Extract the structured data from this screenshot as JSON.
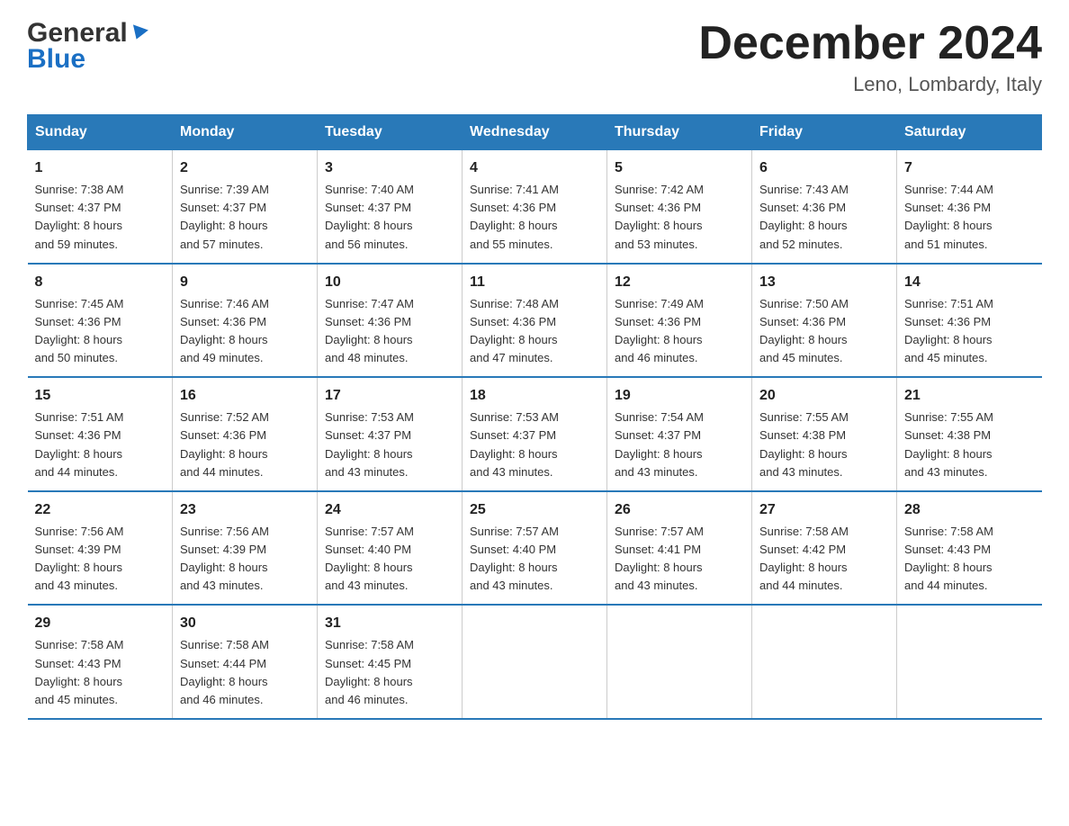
{
  "logo": {
    "general": "General",
    "blue": "Blue"
  },
  "title": {
    "month_year": "December 2024",
    "location": "Leno, Lombardy, Italy"
  },
  "headers": [
    "Sunday",
    "Monday",
    "Tuesday",
    "Wednesday",
    "Thursday",
    "Friday",
    "Saturday"
  ],
  "weeks": [
    [
      {
        "day": "1",
        "sunrise": "Sunrise: 7:38 AM",
        "sunset": "Sunset: 4:37 PM",
        "daylight": "Daylight: 8 hours",
        "daylight2": "and 59 minutes."
      },
      {
        "day": "2",
        "sunrise": "Sunrise: 7:39 AM",
        "sunset": "Sunset: 4:37 PM",
        "daylight": "Daylight: 8 hours",
        "daylight2": "and 57 minutes."
      },
      {
        "day": "3",
        "sunrise": "Sunrise: 7:40 AM",
        "sunset": "Sunset: 4:37 PM",
        "daylight": "Daylight: 8 hours",
        "daylight2": "and 56 minutes."
      },
      {
        "day": "4",
        "sunrise": "Sunrise: 7:41 AM",
        "sunset": "Sunset: 4:36 PM",
        "daylight": "Daylight: 8 hours",
        "daylight2": "and 55 minutes."
      },
      {
        "day": "5",
        "sunrise": "Sunrise: 7:42 AM",
        "sunset": "Sunset: 4:36 PM",
        "daylight": "Daylight: 8 hours",
        "daylight2": "and 53 minutes."
      },
      {
        "day": "6",
        "sunrise": "Sunrise: 7:43 AM",
        "sunset": "Sunset: 4:36 PM",
        "daylight": "Daylight: 8 hours",
        "daylight2": "and 52 minutes."
      },
      {
        "day": "7",
        "sunrise": "Sunrise: 7:44 AM",
        "sunset": "Sunset: 4:36 PM",
        "daylight": "Daylight: 8 hours",
        "daylight2": "and 51 minutes."
      }
    ],
    [
      {
        "day": "8",
        "sunrise": "Sunrise: 7:45 AM",
        "sunset": "Sunset: 4:36 PM",
        "daylight": "Daylight: 8 hours",
        "daylight2": "and 50 minutes."
      },
      {
        "day": "9",
        "sunrise": "Sunrise: 7:46 AM",
        "sunset": "Sunset: 4:36 PM",
        "daylight": "Daylight: 8 hours",
        "daylight2": "and 49 minutes."
      },
      {
        "day": "10",
        "sunrise": "Sunrise: 7:47 AM",
        "sunset": "Sunset: 4:36 PM",
        "daylight": "Daylight: 8 hours",
        "daylight2": "and 48 minutes."
      },
      {
        "day": "11",
        "sunrise": "Sunrise: 7:48 AM",
        "sunset": "Sunset: 4:36 PM",
        "daylight": "Daylight: 8 hours",
        "daylight2": "and 47 minutes."
      },
      {
        "day": "12",
        "sunrise": "Sunrise: 7:49 AM",
        "sunset": "Sunset: 4:36 PM",
        "daylight": "Daylight: 8 hours",
        "daylight2": "and 46 minutes."
      },
      {
        "day": "13",
        "sunrise": "Sunrise: 7:50 AM",
        "sunset": "Sunset: 4:36 PM",
        "daylight": "Daylight: 8 hours",
        "daylight2": "and 45 minutes."
      },
      {
        "day": "14",
        "sunrise": "Sunrise: 7:51 AM",
        "sunset": "Sunset: 4:36 PM",
        "daylight": "Daylight: 8 hours",
        "daylight2": "and 45 minutes."
      }
    ],
    [
      {
        "day": "15",
        "sunrise": "Sunrise: 7:51 AM",
        "sunset": "Sunset: 4:36 PM",
        "daylight": "Daylight: 8 hours",
        "daylight2": "and 44 minutes."
      },
      {
        "day": "16",
        "sunrise": "Sunrise: 7:52 AM",
        "sunset": "Sunset: 4:36 PM",
        "daylight": "Daylight: 8 hours",
        "daylight2": "and 44 minutes."
      },
      {
        "day": "17",
        "sunrise": "Sunrise: 7:53 AM",
        "sunset": "Sunset: 4:37 PM",
        "daylight": "Daylight: 8 hours",
        "daylight2": "and 43 minutes."
      },
      {
        "day": "18",
        "sunrise": "Sunrise: 7:53 AM",
        "sunset": "Sunset: 4:37 PM",
        "daylight": "Daylight: 8 hours",
        "daylight2": "and 43 minutes."
      },
      {
        "day": "19",
        "sunrise": "Sunrise: 7:54 AM",
        "sunset": "Sunset: 4:37 PM",
        "daylight": "Daylight: 8 hours",
        "daylight2": "and 43 minutes."
      },
      {
        "day": "20",
        "sunrise": "Sunrise: 7:55 AM",
        "sunset": "Sunset: 4:38 PM",
        "daylight": "Daylight: 8 hours",
        "daylight2": "and 43 minutes."
      },
      {
        "day": "21",
        "sunrise": "Sunrise: 7:55 AM",
        "sunset": "Sunset: 4:38 PM",
        "daylight": "Daylight: 8 hours",
        "daylight2": "and 43 minutes."
      }
    ],
    [
      {
        "day": "22",
        "sunrise": "Sunrise: 7:56 AM",
        "sunset": "Sunset: 4:39 PM",
        "daylight": "Daylight: 8 hours",
        "daylight2": "and 43 minutes."
      },
      {
        "day": "23",
        "sunrise": "Sunrise: 7:56 AM",
        "sunset": "Sunset: 4:39 PM",
        "daylight": "Daylight: 8 hours",
        "daylight2": "and 43 minutes."
      },
      {
        "day": "24",
        "sunrise": "Sunrise: 7:57 AM",
        "sunset": "Sunset: 4:40 PM",
        "daylight": "Daylight: 8 hours",
        "daylight2": "and 43 minutes."
      },
      {
        "day": "25",
        "sunrise": "Sunrise: 7:57 AM",
        "sunset": "Sunset: 4:40 PM",
        "daylight": "Daylight: 8 hours",
        "daylight2": "and 43 minutes."
      },
      {
        "day": "26",
        "sunrise": "Sunrise: 7:57 AM",
        "sunset": "Sunset: 4:41 PM",
        "daylight": "Daylight: 8 hours",
        "daylight2": "and 43 minutes."
      },
      {
        "day": "27",
        "sunrise": "Sunrise: 7:58 AM",
        "sunset": "Sunset: 4:42 PM",
        "daylight": "Daylight: 8 hours",
        "daylight2": "and 44 minutes."
      },
      {
        "day": "28",
        "sunrise": "Sunrise: 7:58 AM",
        "sunset": "Sunset: 4:43 PM",
        "daylight": "Daylight: 8 hours",
        "daylight2": "and 44 minutes."
      }
    ],
    [
      {
        "day": "29",
        "sunrise": "Sunrise: 7:58 AM",
        "sunset": "Sunset: 4:43 PM",
        "daylight": "Daylight: 8 hours",
        "daylight2": "and 45 minutes."
      },
      {
        "day": "30",
        "sunrise": "Sunrise: 7:58 AM",
        "sunset": "Sunset: 4:44 PM",
        "daylight": "Daylight: 8 hours",
        "daylight2": "and 46 minutes."
      },
      {
        "day": "31",
        "sunrise": "Sunrise: 7:58 AM",
        "sunset": "Sunset: 4:45 PM",
        "daylight": "Daylight: 8 hours",
        "daylight2": "and 46 minutes."
      },
      null,
      null,
      null,
      null
    ]
  ]
}
